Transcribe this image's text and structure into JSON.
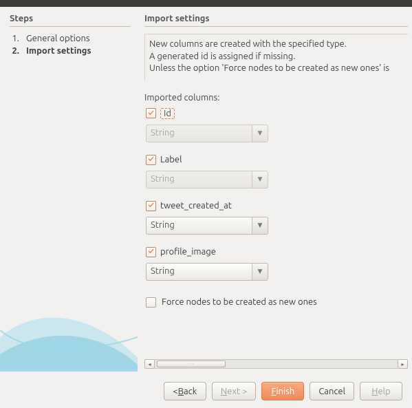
{
  "left": {
    "heading": "Steps",
    "steps": [
      {
        "num": "1.",
        "label": "General options"
      },
      {
        "num": "2.",
        "label": "Import settings"
      }
    ]
  },
  "right": {
    "heading": "Import settings",
    "desc_line1": "New columns are created with the specified type.",
    "desc_line2": "A generated id is assigned if missing.",
    "desc_line3": "Unless the option 'Force nodes to be created as new ones' is",
    "imported_label": "Imported columns:",
    "cols": [
      {
        "name": "Id",
        "type": "String"
      },
      {
        "name": "Label",
        "type": "String"
      },
      {
        "name": "tweet_created_at",
        "type": "String"
      },
      {
        "name": "profile_image",
        "type": "String"
      }
    ],
    "force_label": "Force nodes to be created as new ones"
  },
  "buttons": {
    "back_prefix": "< ",
    "back_mn": "B",
    "back_rest": "ack",
    "next_prefix": "",
    "next_mn": "N",
    "next_rest": "ext >",
    "finish_prefix": "",
    "finish_mn": "F",
    "finish_rest": "inish",
    "cancel": "Cancel",
    "help_mn": "H",
    "help_rest": "elp"
  }
}
